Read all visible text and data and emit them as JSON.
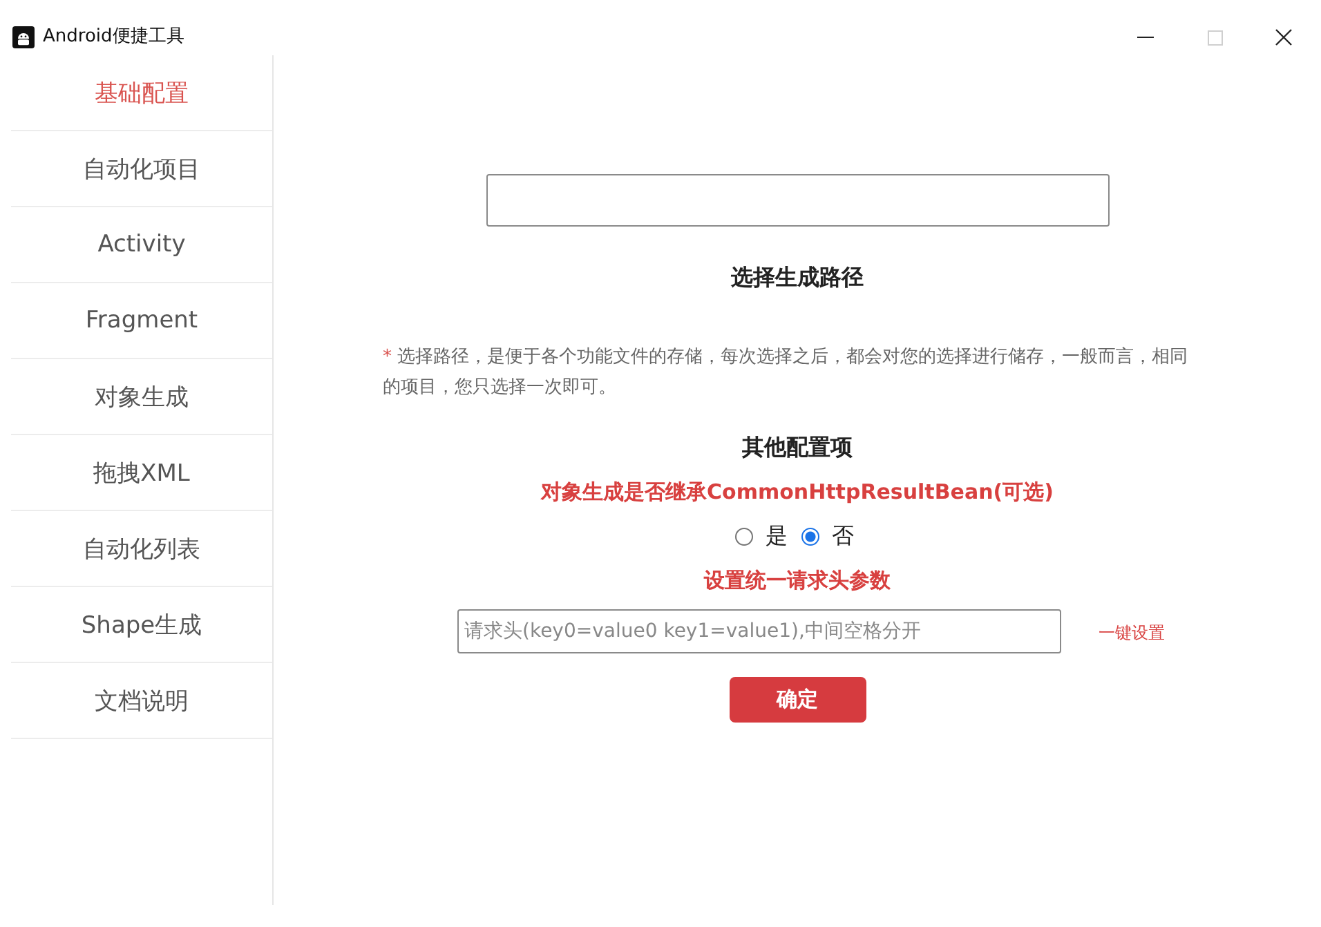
{
  "window": {
    "title": "Android便捷工具",
    "maximize_disabled": true
  },
  "sidebar": {
    "items": [
      {
        "label": "基础配置",
        "selected": true
      },
      {
        "label": "自动化项目",
        "selected": false
      },
      {
        "label": "Activity",
        "selected": false
      },
      {
        "label": "Fragment",
        "selected": false
      },
      {
        "label": "对象生成",
        "selected": false
      },
      {
        "label": "拖拽XML",
        "selected": false
      },
      {
        "label": "自动化列表",
        "selected": false
      },
      {
        "label": "Shape生成",
        "selected": false
      },
      {
        "label": "文档说明",
        "selected": false
      }
    ]
  },
  "path_section": {
    "heading": "选择生成路径",
    "note_mark": "*",
    "note": "选择路径，是便于各个功能文件的存储，每次选择之后，都会对您的选择进行储存，一般而言，相同的项目，您只选择一次即可。"
  },
  "other_section": {
    "heading": "其他配置项",
    "inherit_label": "对象生成是否继承CommonHttpResultBean(可选)",
    "options": [
      {
        "label": "是",
        "selected": false
      },
      {
        "label": "否",
        "selected": true
      }
    ],
    "header_label": "设置统一请求头参数",
    "header_field": {
      "placeholder": "请求头(key0=value0 key1=value1),中间空格分开"
    },
    "apply_link": "一键设置",
    "confirm_button": "确定"
  }
}
